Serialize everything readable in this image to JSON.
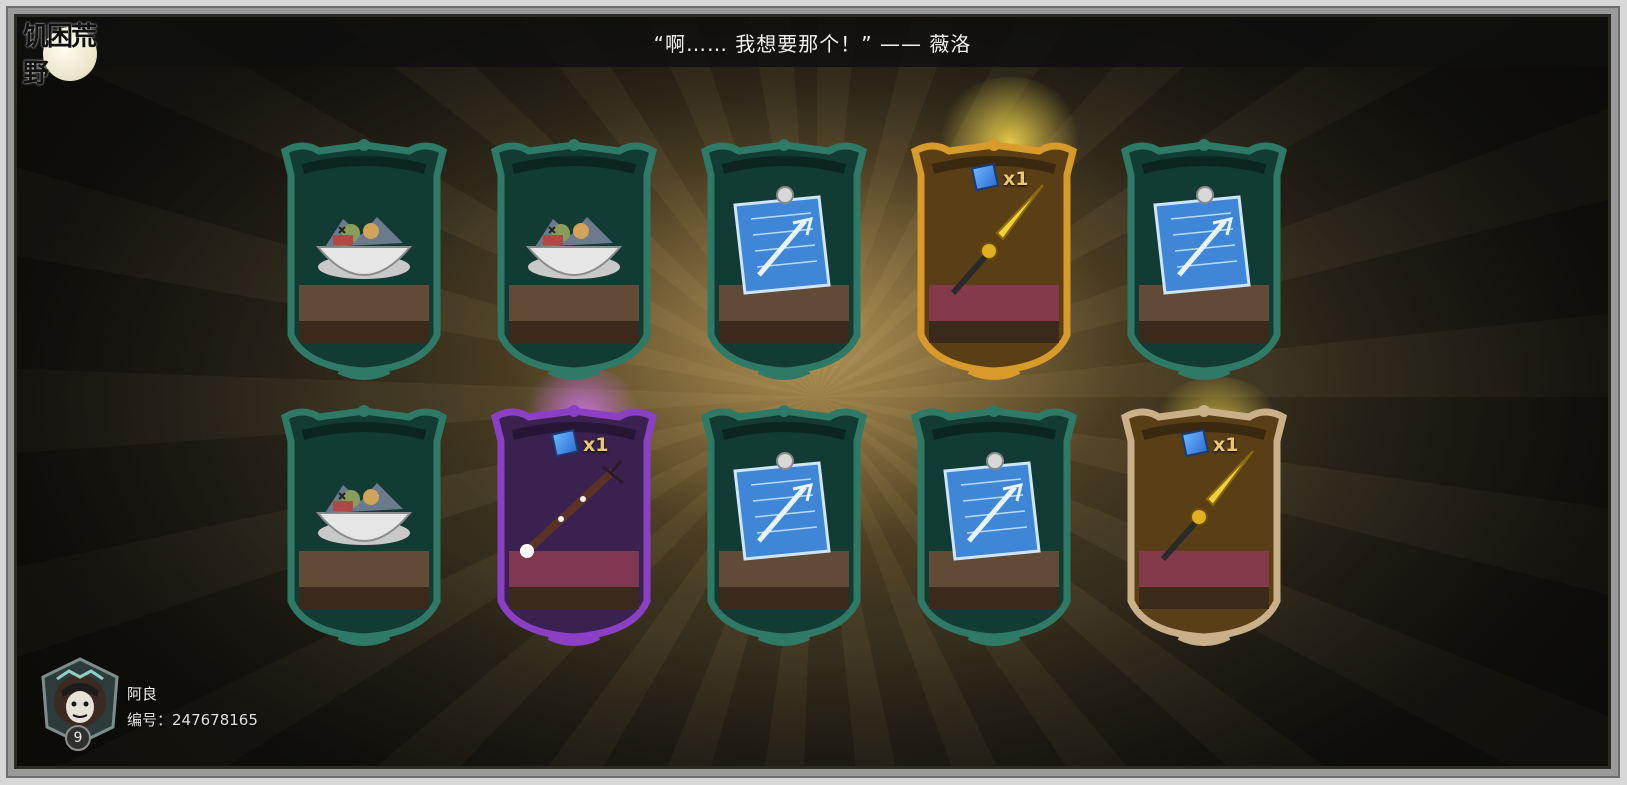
{
  "header": {
    "quote": "“啊…… 我想要那个！”   ——  薇洛"
  },
  "logo": {
    "text": "饥困荒野"
  },
  "rewards": [
    {
      "item": "food-bowl",
      "rarity": "common",
      "frame_color": "#2f7a66",
      "quantity": ""
    },
    {
      "item": "food-bowl",
      "rarity": "common",
      "frame_color": "#2f7a66",
      "quantity": ""
    },
    {
      "item": "blueprint",
      "rarity": "common",
      "frame_color": "#2f7a66",
      "quantity": ""
    },
    {
      "item": "golden-spear",
      "rarity": "legendary",
      "frame_color": "#d89a2a",
      "quantity": "x1"
    },
    {
      "item": "blueprint",
      "rarity": "common",
      "frame_color": "#2f7a66",
      "quantity": ""
    },
    {
      "item": "food-bowl",
      "rarity": "common",
      "frame_color": "#2f7a66",
      "quantity": ""
    },
    {
      "item": "dark-staff",
      "rarity": "epic",
      "frame_color": "#8a3fc4",
      "quantity": "x1"
    },
    {
      "item": "blueprint",
      "rarity": "common",
      "frame_color": "#2f7a66",
      "quantity": ""
    },
    {
      "item": "blueprint",
      "rarity": "common",
      "frame_color": "#2f7a66",
      "quantity": ""
    },
    {
      "item": "golden-spear",
      "rarity": "legendary",
      "frame_color": "#c9b089",
      "quantity": "x1"
    }
  ],
  "player": {
    "name": "阿良",
    "id_label": "编号：247678165",
    "level": "9"
  }
}
